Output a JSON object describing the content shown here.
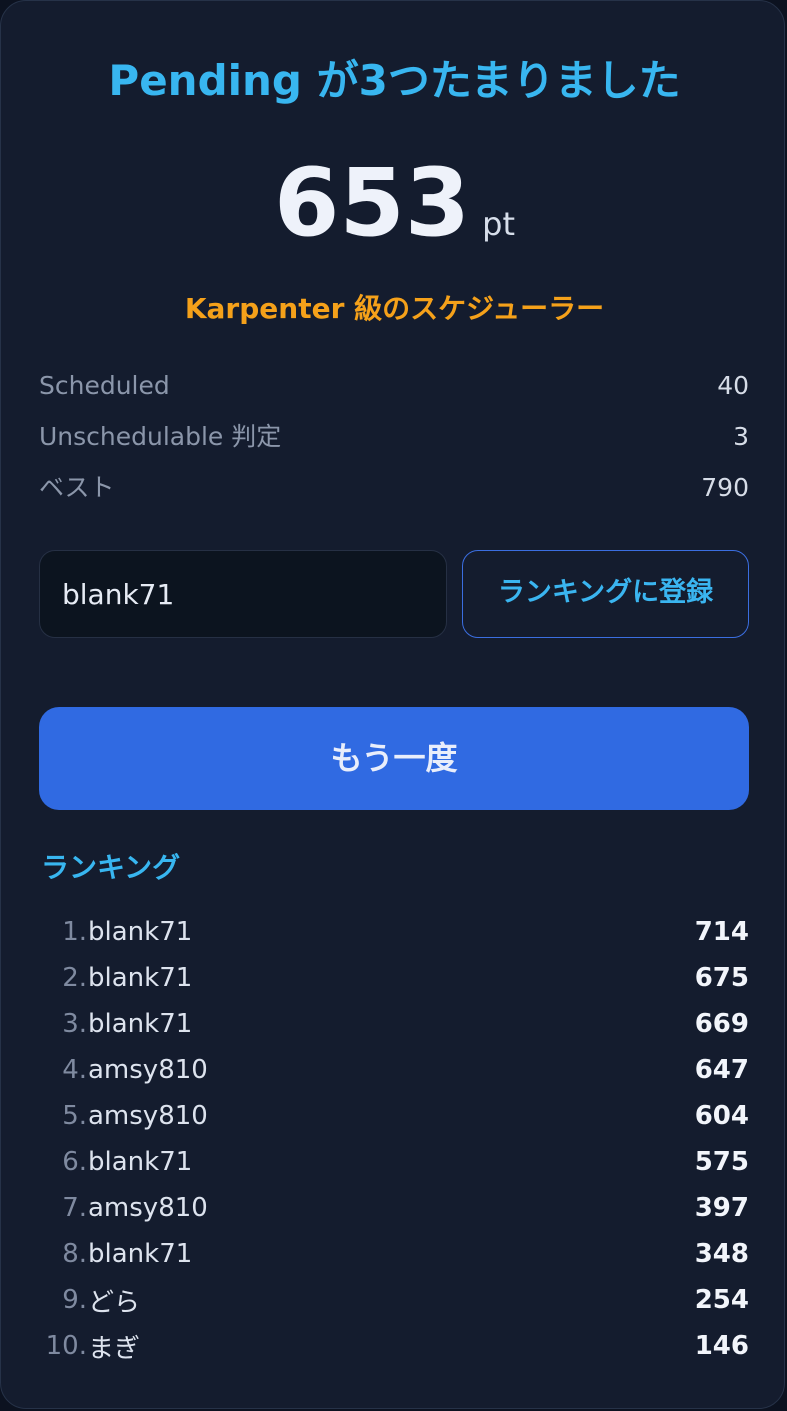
{
  "header": {
    "title": "Pending が3つたまりました"
  },
  "score": {
    "value": "653",
    "unit": "pt"
  },
  "rank_title": "Karpenter 級のスケジューラー",
  "stats": [
    {
      "label": "Scheduled",
      "value": "40"
    },
    {
      "label": "Unschedulable 判定",
      "value": "3"
    },
    {
      "label": "ベスト",
      "value": "790"
    }
  ],
  "register": {
    "name_value": "blank71",
    "button_label": "ランキングに登録"
  },
  "retry_label": "もう一度",
  "ranking": {
    "heading": "ランキング",
    "entries": [
      {
        "rank": "1.",
        "name": "blank71",
        "score": "714"
      },
      {
        "rank": "2.",
        "name": "blank71",
        "score": "675"
      },
      {
        "rank": "3.",
        "name": "blank71",
        "score": "669"
      },
      {
        "rank": "4.",
        "name": "amsy810",
        "score": "647"
      },
      {
        "rank": "5.",
        "name": "amsy810",
        "score": "604"
      },
      {
        "rank": "6.",
        "name": "blank71",
        "score": "575"
      },
      {
        "rank": "7.",
        "name": "amsy810",
        "score": "397"
      },
      {
        "rank": "8.",
        "name": "blank71",
        "score": "348"
      },
      {
        "rank": "9.",
        "name": "どら",
        "score": "254"
      },
      {
        "rank": "10.",
        "name": "まぎ",
        "score": "146"
      }
    ]
  }
}
